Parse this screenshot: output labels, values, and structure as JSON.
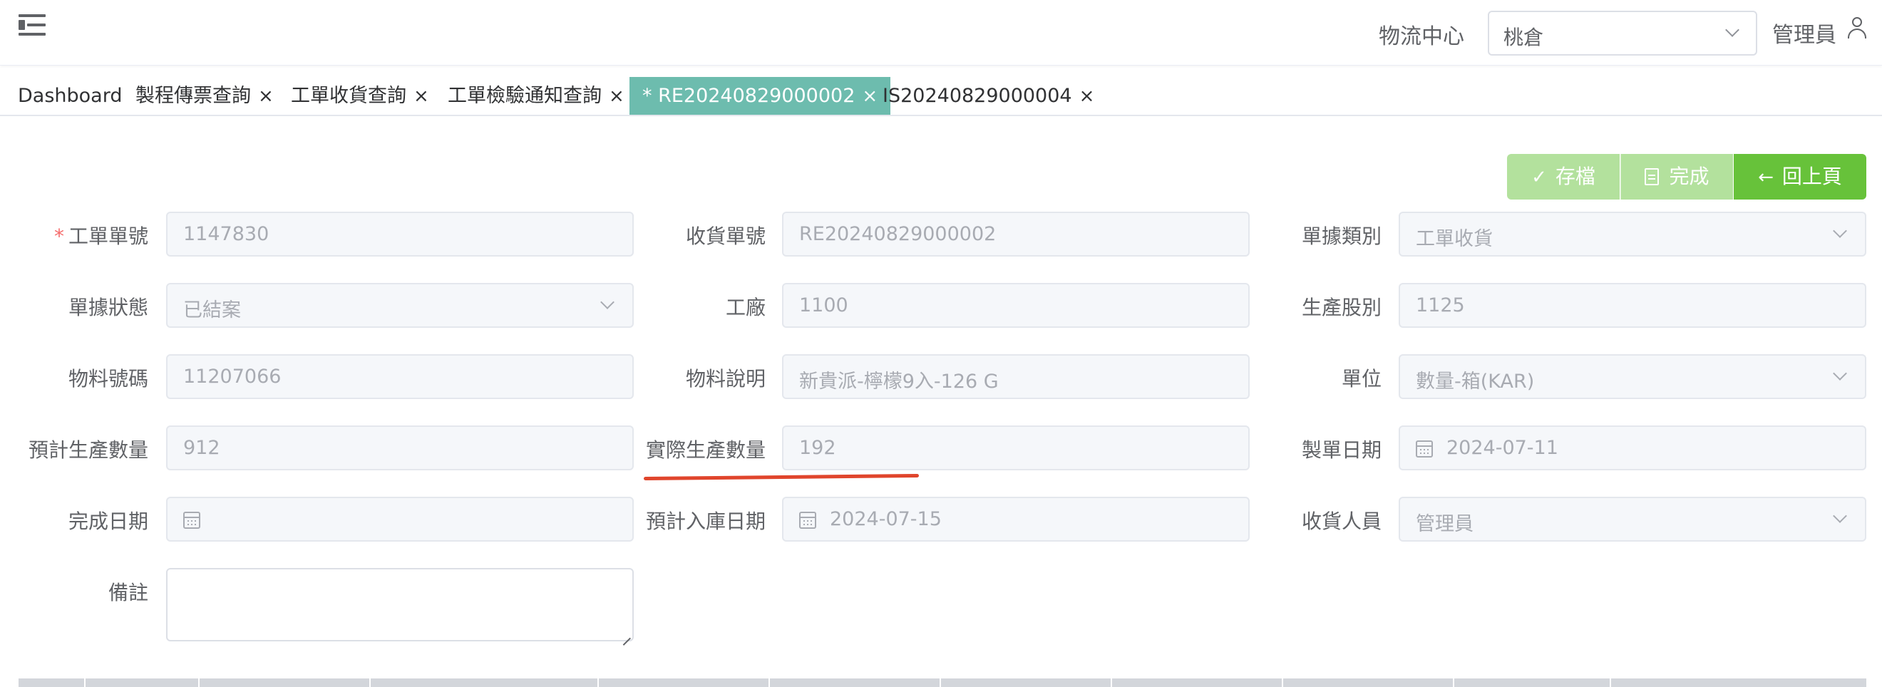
{
  "header": {
    "center_label": "物流中心",
    "center_value": "桃倉",
    "user_name": "管理員"
  },
  "tabs": [
    {
      "label": "Dashboard",
      "closable": false,
      "active": false
    },
    {
      "label": "製程傳票查詢",
      "closable": true,
      "active": false
    },
    {
      "label": "工單收貨查詢",
      "closable": true,
      "active": false
    },
    {
      "label": "工單檢驗通知查詢",
      "closable": true,
      "active": false
    },
    {
      "label": "* RE20240829000002",
      "closable": true,
      "active": true
    },
    {
      "label": "IS20240829000004",
      "closable": true,
      "active": false
    }
  ],
  "tab_close_glyph": "×",
  "actions": {
    "save_label": "存檔",
    "done_label": "完成",
    "back_label": "回上頁"
  },
  "form": {
    "work_order_no": {
      "label": "工單單號",
      "required_mark": "*",
      "value": "1147830"
    },
    "receipt_no": {
      "label": "收貨單號",
      "value": "RE20240829000002"
    },
    "doc_type": {
      "label": "單據類別",
      "value": "工單收貨"
    },
    "doc_status": {
      "label": "單據狀態",
      "value": "已結案"
    },
    "plant": {
      "label": "工廠",
      "value": "1100"
    },
    "prod_group": {
      "label": "生產股別",
      "value": "1125"
    },
    "material_no": {
      "label": "物料號碼",
      "value": "11207066"
    },
    "material_desc": {
      "label": "物料說明",
      "value": "新貴派-檸檬9入-126 G"
    },
    "unit": {
      "label": "單位",
      "value": "數量-箱(KAR)"
    },
    "planned_qty": {
      "label": "預計生產數量",
      "value": "912"
    },
    "actual_qty": {
      "label": "實際生產數量",
      "value": "192"
    },
    "order_date": {
      "label": "製單日期",
      "value": "2024-07-11"
    },
    "finish_date": {
      "label": "完成日期",
      "value": ""
    },
    "expected_stock_date": {
      "label": "預計入庫日期",
      "value": "2024-07-15"
    },
    "receiver": {
      "label": "收貨人員",
      "value": "管理員"
    },
    "remarks": {
      "label": "備註",
      "value": ""
    }
  },
  "colors": {
    "active_tab": "#6dbcae",
    "success": "#67c23a",
    "success_light": "#b3e19d",
    "annotation_underline": "#e0452c",
    "required": "#f56c6c"
  }
}
